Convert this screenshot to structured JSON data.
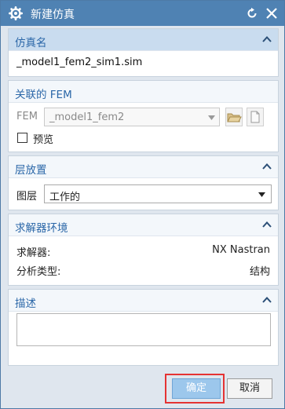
{
  "window": {
    "title": "新建仿真",
    "icons": {
      "app": "gear-icon",
      "reset": "reset-icon",
      "close": "close-icon"
    }
  },
  "sim_name": {
    "header": "仿真名",
    "value": "_model1_fem2_sim1.sim"
  },
  "fem": {
    "header": "关联的 FEM",
    "label": "FEM",
    "selected": "_model1_fem2",
    "preview_label": "预览",
    "preview_checked": false
  },
  "layer": {
    "header": "层放置",
    "label": "图层",
    "selected": "工作的"
  },
  "solver_env": {
    "header": "求解器环境",
    "solver_key": "求解器:",
    "solver_value": "NX Nastran",
    "analysis_key": "分析类型:",
    "analysis_value": "结构"
  },
  "description": {
    "header": "描述",
    "value": ""
  },
  "buttons": {
    "ok": "确定",
    "cancel": "取消"
  },
  "colors": {
    "titlebar": "#4f82b3",
    "header_text": "#2b67a8",
    "highlight": "#e53333",
    "ok_button": "#9cc7ec"
  }
}
